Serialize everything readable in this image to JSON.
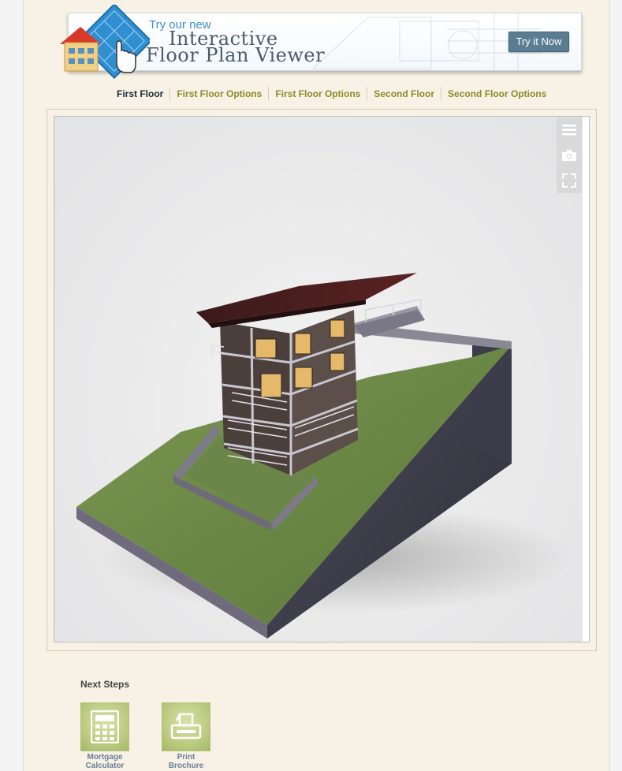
{
  "banner": {
    "line1": "Try our new",
    "line2": "Interactive",
    "line3": "Floor Plan Viewer",
    "button_label": "Try it Now"
  },
  "tabs": [
    {
      "label": "First Floor",
      "active": true
    },
    {
      "label": "First Floor Options",
      "active": false
    },
    {
      "label": "First Floor Options",
      "active": false
    },
    {
      "label": "Second Floor",
      "active": false
    },
    {
      "label": "Second Floor Options",
      "active": false
    }
  ],
  "viewer": {
    "toolbar": [
      {
        "icon": "menu-icon"
      },
      {
        "icon": "camera-icon"
      },
      {
        "icon": "fullscreen-icon"
      }
    ]
  },
  "next_steps": {
    "title": "Next Steps",
    "items": [
      {
        "line1": "Mortgage",
        "line2": "Calculator",
        "icon": "calculator-icon"
      },
      {
        "line1": "Print",
        "line2": "Brochure",
        "icon": "printer-icon"
      }
    ]
  },
  "colors": {
    "page_bg": "#f7f2e5",
    "tab_active": "#1c2b39",
    "tab_inactive": "#8f8a2a",
    "button_bg": "#5b7d92",
    "step_label": "#6a7d98"
  }
}
